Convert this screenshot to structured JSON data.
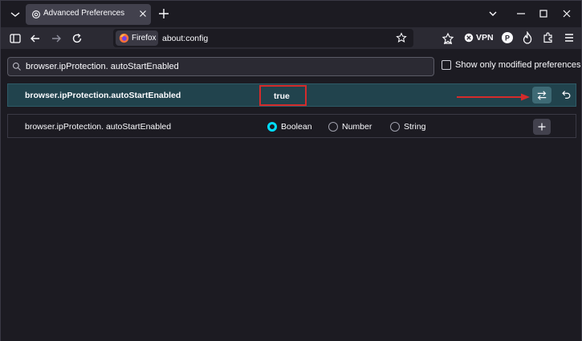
{
  "tab": {
    "title": "Advanced Preferences"
  },
  "urlbar": {
    "identity_label": "Firefox",
    "url": "about:config"
  },
  "toolbar": {
    "vpn_label": "VPN"
  },
  "search": {
    "value": "browser.ipProtection. autoStartEnabled"
  },
  "filter": {
    "label": "Show only modified preferences",
    "checked": false
  },
  "pref_row": {
    "name": "browser.ipProtection.autoStartEnabled",
    "value": "true"
  },
  "new_pref_row": {
    "name": "browser.ipProtection. autoStartEnabled",
    "types": [
      "Boolean",
      "Number",
      "String"
    ],
    "selected_type": "Boolean"
  },
  "colors": {
    "accent": "#00ddff",
    "highlight_row": "#21434d",
    "annotation_red": "#d42b2b"
  }
}
